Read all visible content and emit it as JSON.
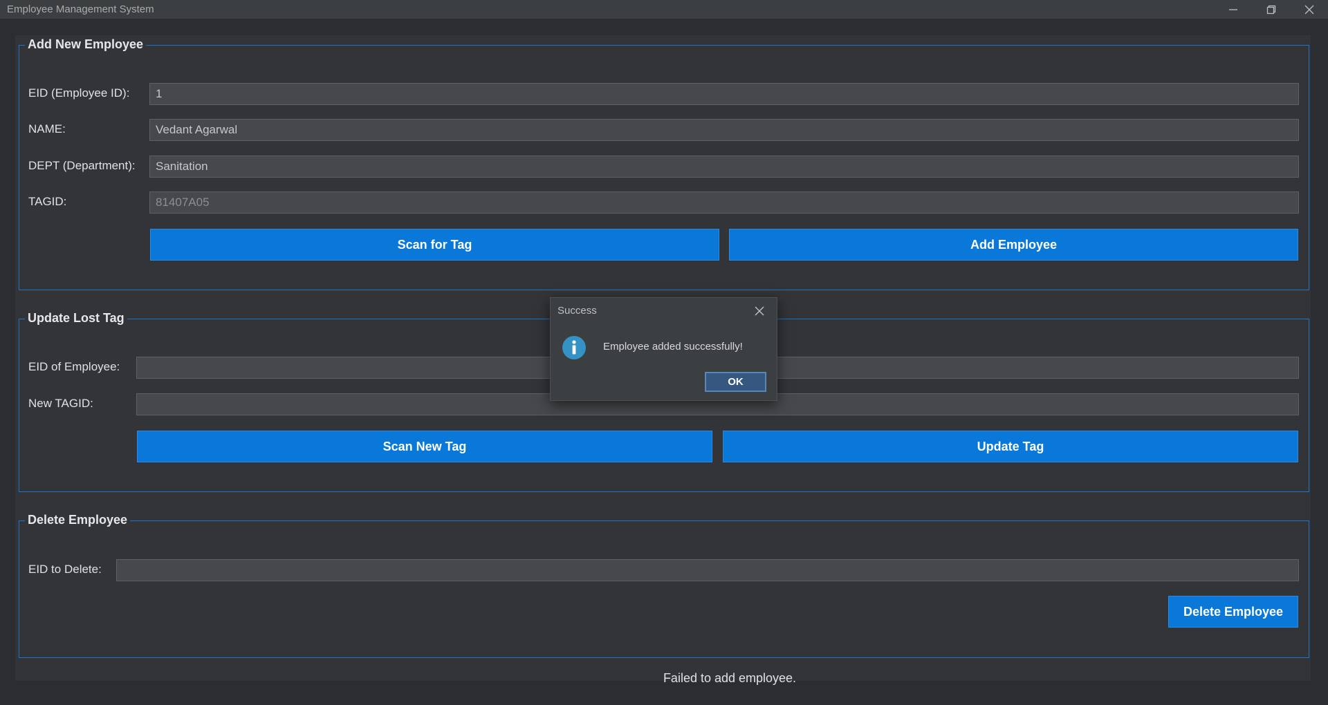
{
  "window": {
    "title": "Employee Management System",
    "controls": [
      "minimize-icon",
      "restore-icon",
      "close-icon"
    ]
  },
  "add_section": {
    "legend": "Add New Employee",
    "eid_label": "EID (Employee ID):",
    "eid_value": "1",
    "name_label": "NAME:",
    "name_value": "Vedant Agarwal",
    "dept_label": "DEPT (Department):",
    "dept_value": "Sanitation",
    "tagid_label": "TAGID:",
    "tagid_value": "81407A05",
    "scan_button": "Scan for Tag",
    "add_button": "Add Employee"
  },
  "update_section": {
    "legend": "Update Lost Tag",
    "eid_label": "EID of Employee:",
    "eid_value": "",
    "tagid_label": "New TAGID:",
    "tagid_value": "",
    "scan_button": "Scan New Tag",
    "update_button": "Update Tag"
  },
  "delete_section": {
    "legend": "Delete Employee",
    "eid_label": "EID to Delete:",
    "eid_value": "",
    "delete_button": "Delete Employee"
  },
  "status_text": "Failed to add employee.",
  "dialog": {
    "title": "Success",
    "message": "Employee added successfully!",
    "ok_button": "OK",
    "icon": "info-icon"
  },
  "colors": {
    "accent": "#0a78d8",
    "border": "#1e74c7",
    "background": "#2b2d30",
    "panel": "#323438"
  }
}
